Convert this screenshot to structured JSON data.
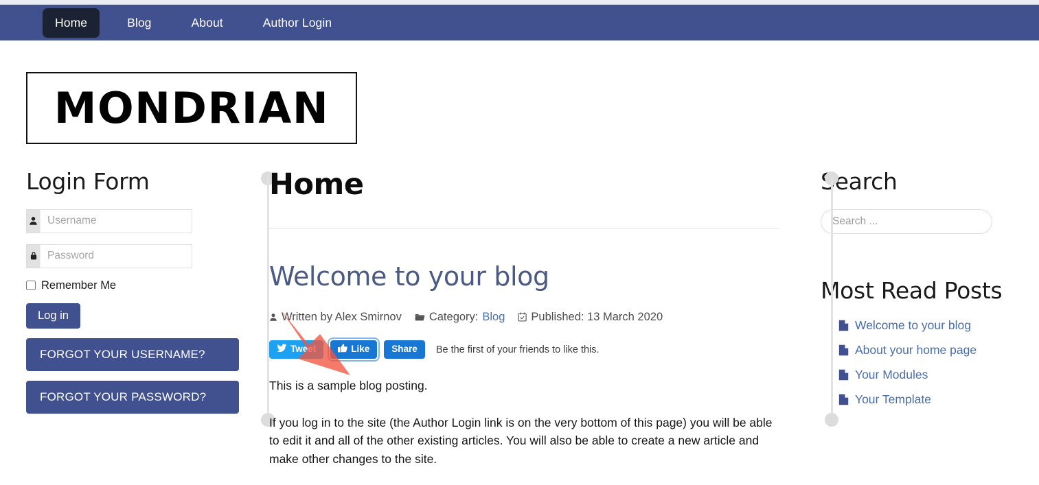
{
  "navbar": {
    "items": [
      {
        "label": "Home",
        "active": true
      },
      {
        "label": "Blog",
        "active": false
      },
      {
        "label": "About",
        "active": false
      },
      {
        "label": "Author Login",
        "active": false
      }
    ]
  },
  "logo": {
    "text": "MONDRIAN"
  },
  "login_form": {
    "title": "Login Form",
    "username": {
      "placeholder": "Username",
      "value": "",
      "icon": "user-icon"
    },
    "password": {
      "placeholder": "Password",
      "value": "",
      "icon": "lock-icon"
    },
    "remember_label": "Remember Me",
    "remember_checked": false,
    "login_button": "Log in",
    "forgot_username": "FORGOT YOUR USERNAME?",
    "forgot_password": "FORGOT YOUR PASSWORD?"
  },
  "main": {
    "page_title": "Home",
    "article": {
      "title": "Welcome to your blog",
      "author_prefix": "Written by",
      "author": "Alex Smirnov",
      "author_line": "Written by Alex Smirnov",
      "category_label": "Category:",
      "category": "Blog",
      "published_label": "Published:",
      "published_date": "13 March 2020",
      "published_line": "Published: 13 March 2020",
      "paragraph_1": "This is a sample blog posting.",
      "paragraph_2": "If you log in to the site (the Author Login link is on the very bottom of this page) you will be able to edit it and all of the other existing articles. You will also be able to create a new article and make other changes to the site."
    },
    "social": {
      "tweet_label": "Tweet",
      "like_label": "Like",
      "share_label": "Share",
      "note": "Be the first of your friends to like this."
    }
  },
  "sidebar_right": {
    "search_title": "Search",
    "search_placeholder": "Search ...",
    "search_value": "",
    "most_read_title": "Most Read Posts",
    "most_read_items": [
      {
        "label": "Welcome to your blog"
      },
      {
        "label": "About your home page"
      },
      {
        "label": "Your Modules"
      },
      {
        "label": "Your Template"
      }
    ]
  },
  "colors": {
    "nav_background": "#41518f",
    "nav_active": "#1b2233",
    "link_blue": "#4a6ea9",
    "heading_blue": "#4a5a85",
    "twitter_blue": "#1da1f2",
    "facebook_blue": "#1877d2",
    "annotation_red": "#f4553f"
  }
}
